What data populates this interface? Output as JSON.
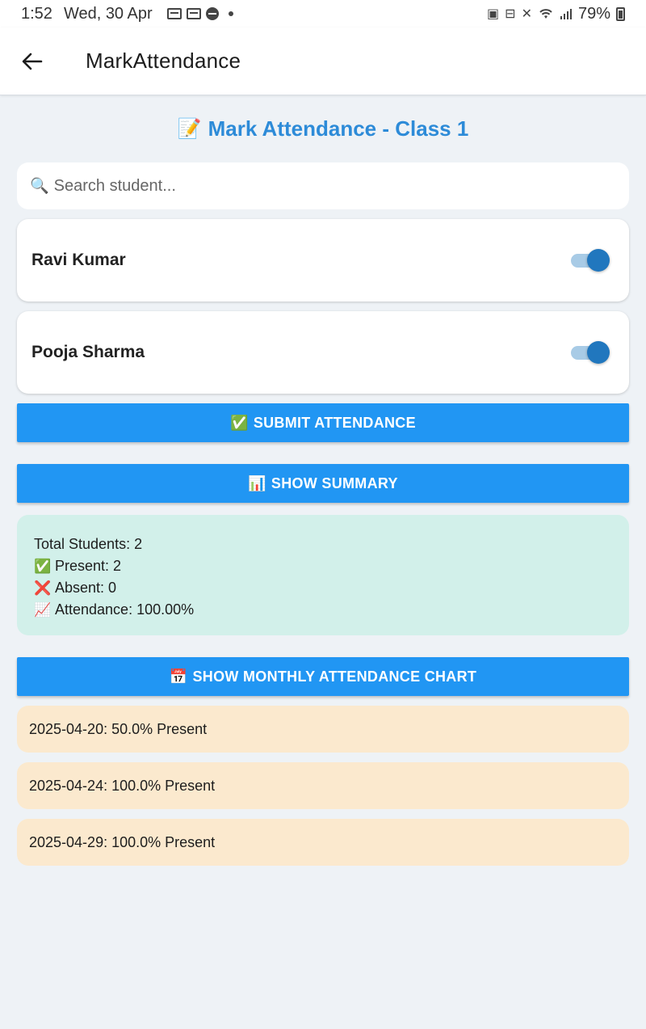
{
  "status_bar": {
    "time": "1:52",
    "date": "Wed, 30 Apr",
    "battery": "79%"
  },
  "app_bar": {
    "title": "MarkAttendance"
  },
  "page": {
    "title_icon": "📝",
    "title": "Mark Attendance - Class 1"
  },
  "search": {
    "icon": "🔍",
    "placeholder": "Search student...",
    "value": ""
  },
  "students": [
    {
      "name": "Ravi Kumar",
      "present": true
    },
    {
      "name": "Pooja Sharma",
      "present": true
    }
  ],
  "buttons": {
    "submit": {
      "icon": "✅",
      "label": "SUBMIT ATTENDANCE"
    },
    "summary": {
      "icon": "📊",
      "label": "SHOW SUMMARY"
    },
    "chart": {
      "icon": "📅",
      "label": "SHOW MONTHLY ATTENDANCE CHART"
    }
  },
  "summary": {
    "total": "Total Students: 2",
    "present": "Present: 2",
    "absent": "Absent: 0",
    "attendance": "Attendance: 100.00%"
  },
  "records": [
    "2025-04-20: 50.0% Present",
    "2025-04-24: 100.0% Present",
    "2025-04-29: 100.0% Present"
  ],
  "colors": {
    "accent": "#2196f3",
    "title": "#2d8bd8",
    "summary_bg": "#d2f0ea",
    "record_bg": "#fbe9ce",
    "toggle_on": "#2177be"
  }
}
